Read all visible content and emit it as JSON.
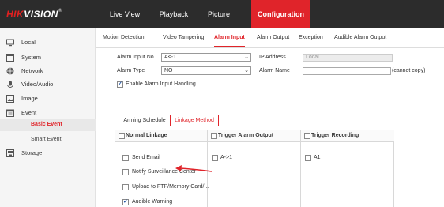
{
  "brand": {
    "mark": "HIK",
    "rest": "VISION",
    "reg": "®"
  },
  "colors": {
    "accent": "#e0242a",
    "topbar": "#2c2c2c",
    "sidebar": "#f5f5f5"
  },
  "top_nav": [
    {
      "label": "Live View",
      "active": false
    },
    {
      "label": "Playback",
      "active": false
    },
    {
      "label": "Picture",
      "active": false
    },
    {
      "label": "Configuration",
      "active": true
    }
  ],
  "sidebar": {
    "items": [
      {
        "label": "Local",
        "icon": "monitor-icon"
      },
      {
        "label": "System",
        "icon": "system-icon"
      },
      {
        "label": "Network",
        "icon": "globe-icon"
      },
      {
        "label": "Video/Audio",
        "icon": "mic-icon"
      },
      {
        "label": "Image",
        "icon": "image-icon"
      },
      {
        "label": "Event",
        "icon": "calendar-icon"
      },
      {
        "label": "Storage",
        "icon": "storage-icon"
      }
    ],
    "sub_items": [
      {
        "label": "Basic Event",
        "active": true
      },
      {
        "label": "Smart Event",
        "active": false
      }
    ]
  },
  "sub_tabs": [
    {
      "label": "Motion Detection",
      "active": false
    },
    {
      "label": "Video Tampering",
      "active": false
    },
    {
      "label": "Alarm Input",
      "active": true
    },
    {
      "label": "Alarm Output",
      "active": false
    },
    {
      "label": "Exception",
      "active": false
    },
    {
      "label": "Audible Alarm Output",
      "active": false
    }
  ],
  "form": {
    "alarm_input_no_label": "Alarm Input No.",
    "alarm_input_no_value": "A<-1",
    "alarm_type_label": "Alarm Type",
    "alarm_type_value": "NO",
    "ip_address_label": "IP Address",
    "ip_address_value": "Local",
    "alarm_name_label": "Alarm Name",
    "alarm_name_value": "",
    "cannot_copy": "(cannot copy)",
    "enable_label": "Enable Alarm Input Handling",
    "enable_checked": true
  },
  "inner_tabs": [
    {
      "label": "Arming Schedule",
      "active": false
    },
    {
      "label": "Linkage Method",
      "active": true
    }
  ],
  "linkage": {
    "columns": [
      {
        "title": "Normal Linkage",
        "checked": false
      },
      {
        "title": "Trigger Alarm Output",
        "checked": false
      },
      {
        "title": "Trigger Recording",
        "checked": false
      }
    ],
    "normal": [
      {
        "label": "Send Email",
        "checked": false
      },
      {
        "label": "Notify Surveillance Center",
        "checked": false
      },
      {
        "label": "Upload to FTP/Memory Card/...",
        "checked": false
      },
      {
        "label": "Audible Warning",
        "checked": true
      }
    ],
    "alarm_outputs": [
      {
        "label": "A->1",
        "checked": false
      }
    ],
    "recording": [
      {
        "label": "A1",
        "checked": false
      }
    ]
  }
}
